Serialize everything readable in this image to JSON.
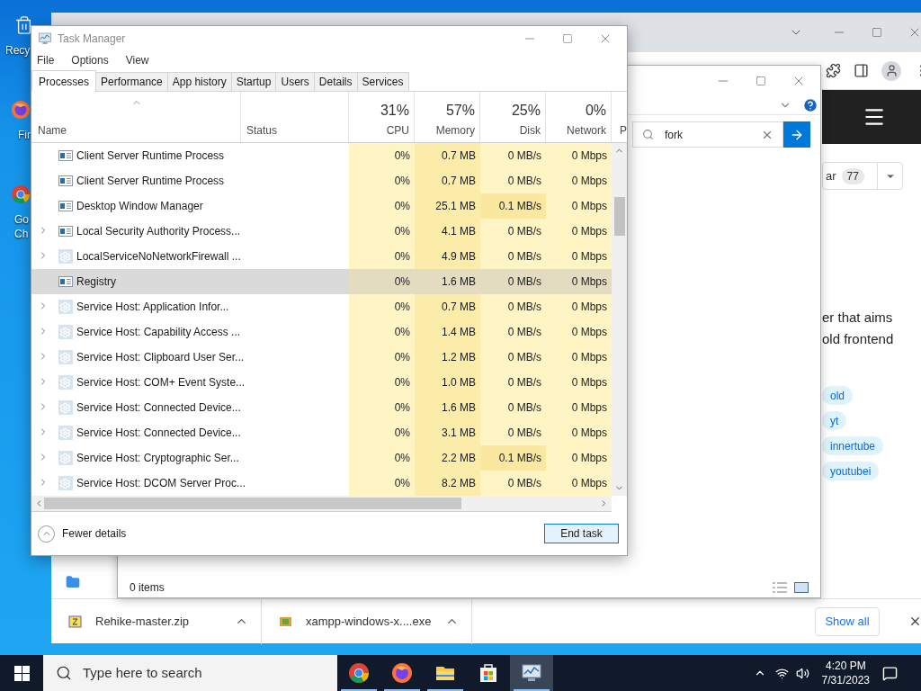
{
  "desktop_icons": [
    {
      "label": "Recy",
      "kind": "recycle"
    },
    {
      "label": "Fir",
      "kind": "firefox"
    },
    {
      "label": "Go Ch",
      "kind": "chrome"
    }
  ],
  "browser": {
    "star_button": {
      "label": "ar",
      "count": "77"
    },
    "description_lines": [
      "er that aims",
      "old frontend"
    ],
    "tags": [
      "old",
      "yt",
      "innertube",
      "youtubei"
    ],
    "downloads": [
      {
        "name": "Rehike-master.zip",
        "kind": "zip"
      },
      {
        "name": "xampp-windows-x....exe",
        "kind": "installer"
      }
    ],
    "show_all": "Show all"
  },
  "explorer": {
    "search": {
      "value": "fork"
    },
    "status": "0 items"
  },
  "task_manager": {
    "title": "Task Manager",
    "menu": [
      "File",
      "Options",
      "View"
    ],
    "tabs": [
      {
        "label": "Processes",
        "selected": true
      },
      {
        "label": "Performance",
        "selected": false
      },
      {
        "label": "App history",
        "selected": false
      },
      {
        "label": "Startup",
        "selected": false
      },
      {
        "label": "Users",
        "selected": false
      },
      {
        "label": "Details",
        "selected": false
      },
      {
        "label": "Services",
        "selected": false
      }
    ],
    "name_column": "Name",
    "status_column": "Status",
    "metric_columns": [
      {
        "usage": "31%",
        "label": "CPU"
      },
      {
        "usage": "57%",
        "label": "Memory"
      },
      {
        "usage": "25%",
        "label": "Disk"
      },
      {
        "usage": "0%",
        "label": "Network"
      }
    ],
    "cut_column": "P",
    "rows": [
      {
        "name": "Client Server Runtime Process",
        "kind": "app",
        "expandable": false,
        "selected": false,
        "disk_busy": false,
        "cpu": "0%",
        "memory": "0.7 MB",
        "disk": "0 MB/s",
        "network": "0 Mbps"
      },
      {
        "name": "Client Server Runtime Process",
        "kind": "app",
        "expandable": false,
        "selected": false,
        "disk_busy": false,
        "cpu": "0%",
        "memory": "0.7 MB",
        "disk": "0 MB/s",
        "network": "0 Mbps"
      },
      {
        "name": "Desktop Window Manager",
        "kind": "app",
        "expandable": false,
        "selected": false,
        "disk_busy": true,
        "cpu": "0%",
        "memory": "25.1 MB",
        "disk": "0.1 MB/s",
        "network": "0 Mbps"
      },
      {
        "name": "Local Security Authority Process...",
        "kind": "app",
        "expandable": true,
        "selected": false,
        "disk_busy": false,
        "cpu": "0%",
        "memory": "4.1 MB",
        "disk": "0 MB/s",
        "network": "0 Mbps"
      },
      {
        "name": "LocalServiceNoNetworkFirewall ...",
        "kind": "gear",
        "expandable": true,
        "selected": false,
        "disk_busy": false,
        "cpu": "0%",
        "memory": "4.9 MB",
        "disk": "0 MB/s",
        "network": "0 Mbps"
      },
      {
        "name": "Registry",
        "kind": "app",
        "expandable": false,
        "selected": true,
        "disk_busy": false,
        "cpu": "0%",
        "memory": "1.6 MB",
        "disk": "0 MB/s",
        "network": "0 Mbps"
      },
      {
        "name": "Service Host: Application Infor...",
        "kind": "gear",
        "expandable": true,
        "selected": false,
        "disk_busy": false,
        "cpu": "0%",
        "memory": "0.7 MB",
        "disk": "0 MB/s",
        "network": "0 Mbps"
      },
      {
        "name": "Service Host: Capability Access ...",
        "kind": "gear",
        "expandable": true,
        "selected": false,
        "disk_busy": false,
        "cpu": "0%",
        "memory": "1.4 MB",
        "disk": "0 MB/s",
        "network": "0 Mbps"
      },
      {
        "name": "Service Host: Clipboard User Ser...",
        "kind": "gear",
        "expandable": true,
        "selected": false,
        "disk_busy": false,
        "cpu": "0%",
        "memory": "1.2 MB",
        "disk": "0 MB/s",
        "network": "0 Mbps"
      },
      {
        "name": "Service Host: COM+ Event Syste...",
        "kind": "gear",
        "expandable": true,
        "selected": false,
        "disk_busy": false,
        "cpu": "0%",
        "memory": "1.0 MB",
        "disk": "0 MB/s",
        "network": "0 Mbps"
      },
      {
        "name": "Service Host: Connected Device...",
        "kind": "gear",
        "expandable": true,
        "selected": false,
        "disk_busy": false,
        "cpu": "0%",
        "memory": "1.6 MB",
        "disk": "0 MB/s",
        "network": "0 Mbps"
      },
      {
        "name": "Service Host: Connected Device...",
        "kind": "gear",
        "expandable": true,
        "selected": false,
        "disk_busy": false,
        "cpu": "0%",
        "memory": "3.1 MB",
        "disk": "0 MB/s",
        "network": "0 Mbps"
      },
      {
        "name": "Service Host: Cryptographic Ser...",
        "kind": "gear",
        "expandable": true,
        "selected": false,
        "disk_busy": true,
        "cpu": "0%",
        "memory": "2.2 MB",
        "disk": "0.1 MB/s",
        "network": "0 Mbps"
      },
      {
        "name": "Service Host: DCOM Server Proc...",
        "kind": "gear",
        "expandable": true,
        "selected": false,
        "disk_busy": false,
        "cpu": "0%",
        "memory": "8.2 MB",
        "disk": "0 MB/s",
        "network": "0 Mbps"
      }
    ],
    "fewer_details": "Fewer details",
    "end_task": "End task"
  },
  "taskbar": {
    "search_placeholder": "Type here to search",
    "apps": [
      {
        "kind": "chrome",
        "open": true,
        "selected": false
      },
      {
        "kind": "firefox",
        "open": true,
        "selected": false
      },
      {
        "kind": "folder",
        "open": true,
        "selected": false
      },
      {
        "kind": "store",
        "open": false,
        "selected": false
      },
      {
        "kind": "taskmanager",
        "open": true,
        "selected": true
      }
    ],
    "time": "4:20 PM",
    "date": "7/31/2023"
  }
}
